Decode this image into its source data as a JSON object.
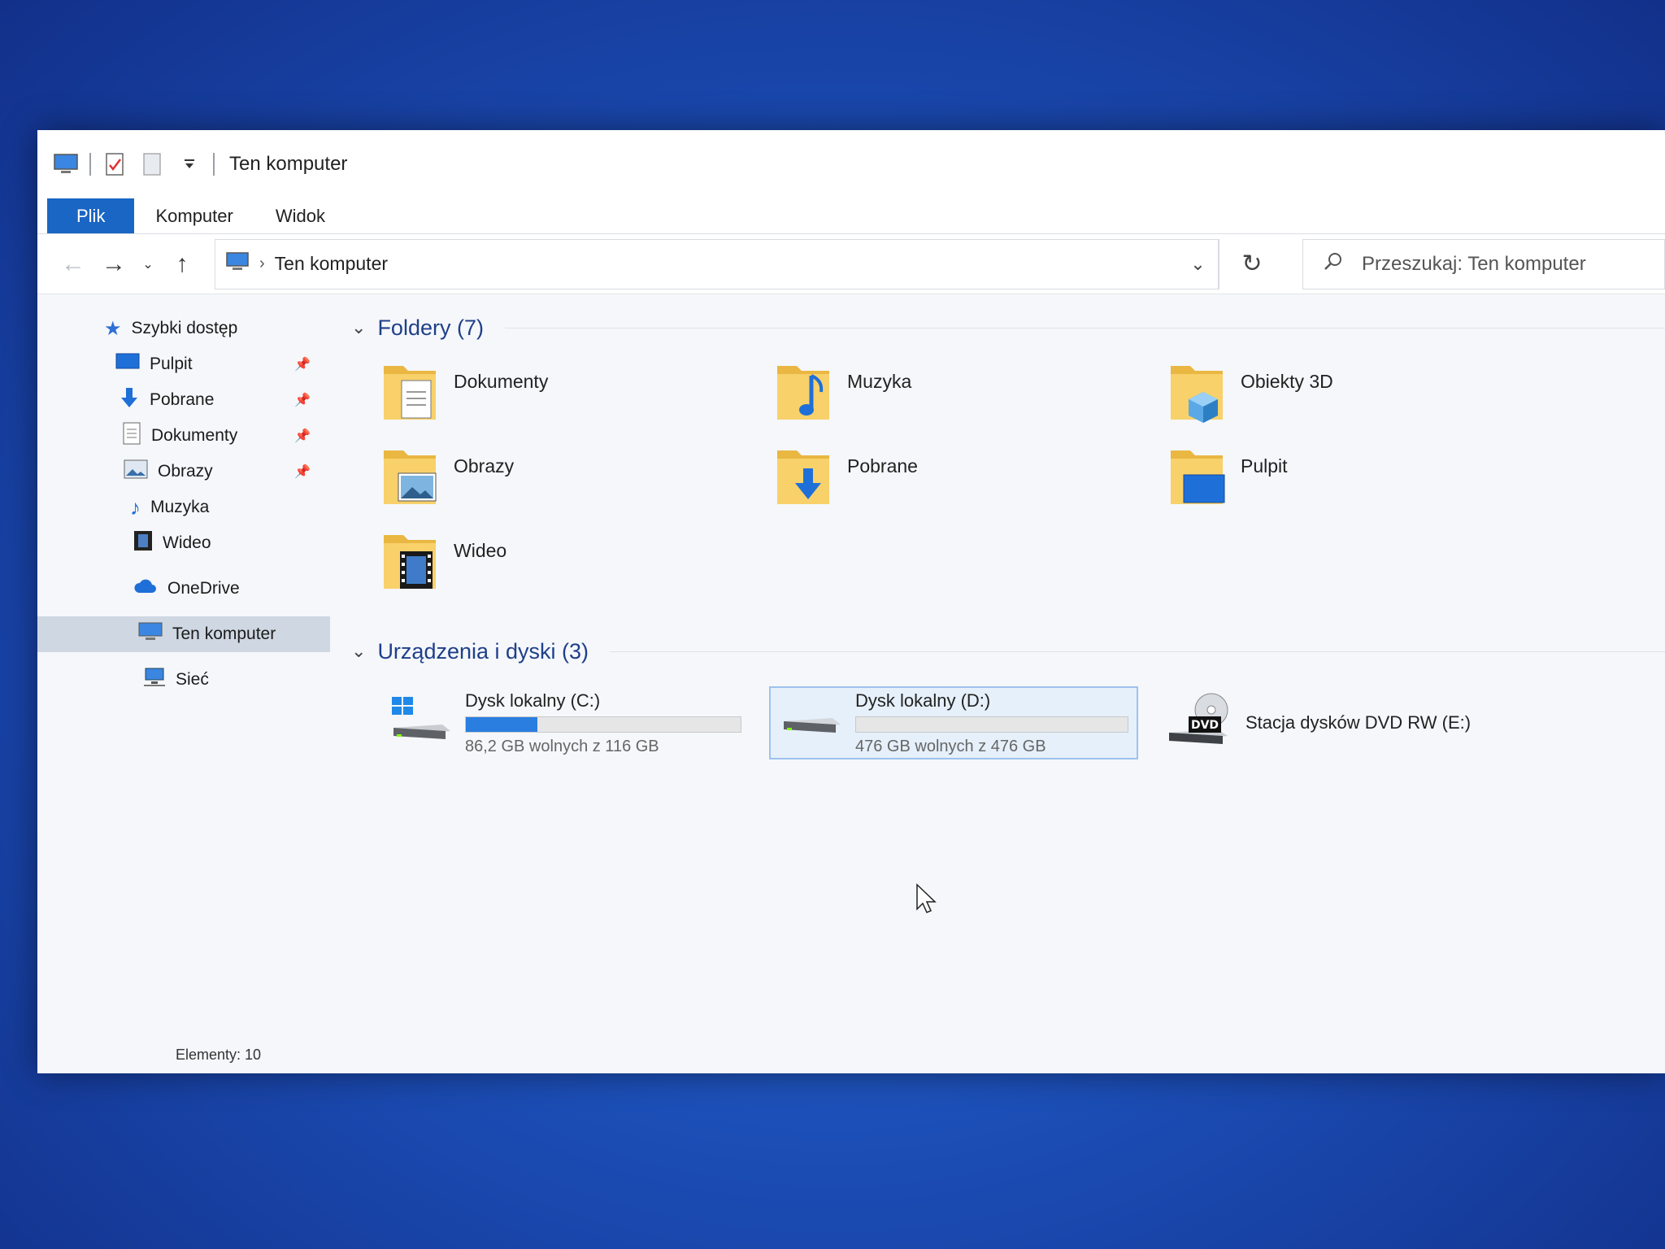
{
  "window": {
    "title": "Ten komputer"
  },
  "ribbon": {
    "tabs": [
      "Plik",
      "Komputer",
      "Widok"
    ]
  },
  "address": {
    "path": "Ten komputer",
    "search_placeholder": "Przeszukaj: Ten komputer"
  },
  "nav": {
    "quick_access": "Szybki dostęp",
    "pinned": [
      {
        "label": "Pulpit",
        "icon": "desktop-icon"
      },
      {
        "label": "Pobrane",
        "icon": "download-icon"
      },
      {
        "label": "Dokumenty",
        "icon": "documents-icon"
      },
      {
        "label": "Obrazy",
        "icon": "pictures-icon"
      }
    ],
    "others": [
      {
        "label": "Muzyka",
        "icon": "music-icon"
      },
      {
        "label": "Wideo",
        "icon": "video-icon"
      }
    ],
    "onedrive": "OneDrive",
    "this_pc": "Ten komputer",
    "network": "Sieć"
  },
  "folders_group": {
    "header": "Foldery (7)",
    "items": [
      "Dokumenty",
      "Muzyka",
      "Obiekty 3D",
      "Obrazy",
      "Pobrane",
      "Pulpit",
      "Wideo"
    ]
  },
  "drives_group": {
    "header": "Urządzenia i dyski (3)",
    "items": [
      {
        "name": "Dysk lokalny (C:)",
        "free": "86,2 GB wolnych z 116 GB",
        "used_fraction": 0.26
      },
      {
        "name": "Dysk lokalny (D:)",
        "free": "476 GB wolnych z 476 GB",
        "used_fraction": 0.0
      },
      {
        "name": "Stacja dysków DVD RW (E:)"
      }
    ]
  },
  "status": {
    "items": "Elementy: 10"
  },
  "colors": {
    "accent": "#1a66c4",
    "folder": "#f8d16b",
    "drive_fill": "#2a7ee0",
    "desktop": "#1c4fb8"
  }
}
